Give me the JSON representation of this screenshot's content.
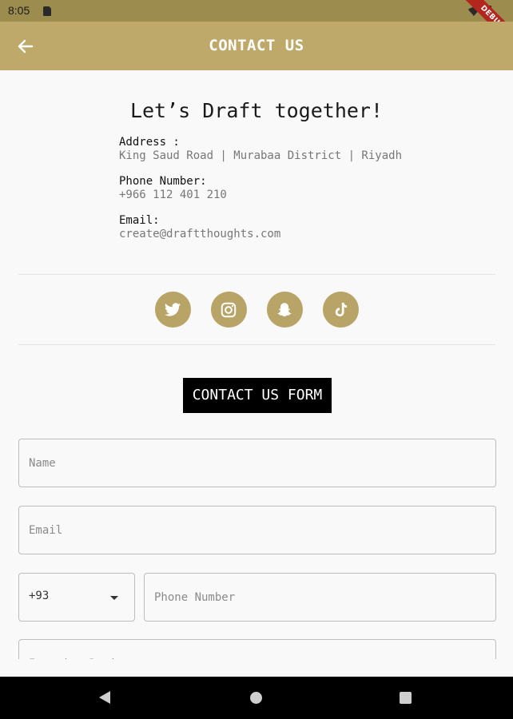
{
  "status_bar": {
    "time": "8:05",
    "debug_label": "DEBUG"
  },
  "app_bar": {
    "title": "CONTACT US",
    "back_icon": "arrow-left-icon"
  },
  "contact_info": {
    "headline": "Let’s Draft together!",
    "address_label": "Address :",
    "address_value": "King Saud Road | Murabaa District | Riyadh",
    "phone_label": "Phone Number:",
    "phone_value": "+966 112 401 210",
    "email_label": "Email:",
    "email_value": "create@draftthoughts.com"
  },
  "social": [
    {
      "name": "twitter-icon"
    },
    {
      "name": "instagram-icon"
    },
    {
      "name": "snapchat-icon"
    },
    {
      "name": "tiktok-icon"
    }
  ],
  "form": {
    "title": "CONTACT US FORM",
    "name_placeholder": "Name",
    "email_placeholder": "Email",
    "country_code": "+93",
    "phone_placeholder": "Phone Number",
    "interior_placeholder": "Interior Design"
  },
  "colors": {
    "accent": "#bfa96a",
    "icon_bg": "#b9a467",
    "status_bar": "#9c8c4e"
  }
}
